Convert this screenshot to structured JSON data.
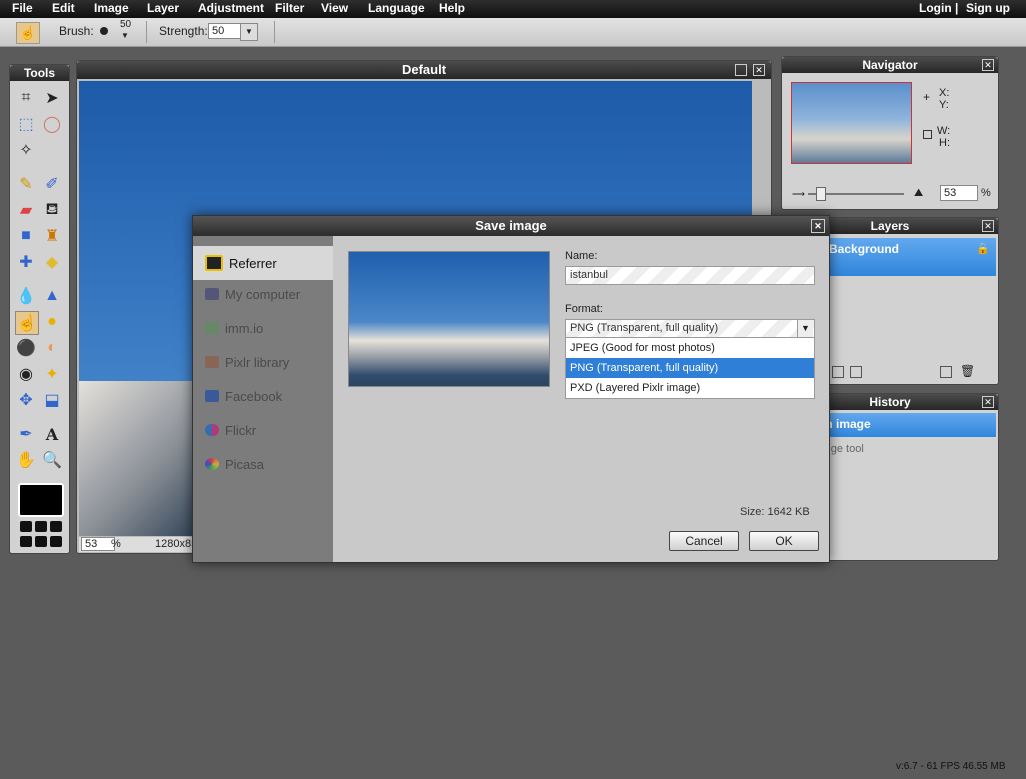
{
  "menu": {
    "items": [
      "File",
      "Edit",
      "Image",
      "Layer",
      "Adjustment",
      "Filter",
      "View",
      "Language",
      "Help"
    ],
    "login": "Login",
    "separator": "|",
    "signup": "Sign up"
  },
  "options": {
    "brush_label": "Brush:",
    "brush_size": "50",
    "strength_label": "Strength:",
    "strength_value": "50"
  },
  "tools_panel": {
    "title": "Tools"
  },
  "document": {
    "title": "Default",
    "zoom": "53",
    "zoom_unit": "%",
    "dimensions": "1280x85"
  },
  "navigator": {
    "title": "Navigator",
    "x_label": "X:",
    "y_label": "Y:",
    "w_label": "W:",
    "h_label": "H:",
    "zoom_value": "53",
    "zoom_unit": "%"
  },
  "layers": {
    "title": "Layers",
    "layer_name": "Background"
  },
  "history": {
    "title": "History",
    "items": [
      "Open image",
      "Smudge tool"
    ]
  },
  "dialog": {
    "title": "Save image",
    "sidebar": [
      "Referrer",
      "My computer",
      "imm.io",
      "Pixlr library",
      "Facebook",
      "Flickr",
      "Picasa"
    ],
    "name_label": "Name:",
    "name_value": "istanbul",
    "format_label": "Format:",
    "format_selected": "PNG (Transparent, full quality)",
    "format_options": [
      "JPEG (Good for most photos)",
      "PNG (Transparent, full quality)",
      "PXD (Layered Pixlr image)"
    ],
    "size_text": "Size: 1642 KB",
    "cancel": "Cancel",
    "ok": "OK"
  },
  "footer": {
    "status": "v:6.7 - 61 FPS 46.55 MB"
  },
  "colors": {
    "accent": "#3c8fe0",
    "selected_option": "#2f7fd8",
    "background": "#5b5b5b"
  }
}
